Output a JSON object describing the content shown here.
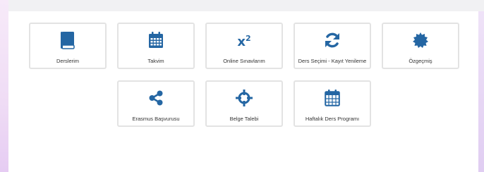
{
  "colors": {
    "icon": "#2466a3",
    "tile_border": "#e3e3e3",
    "label": "#333333"
  },
  "tiles": [
    {
      "label": "Derslerim",
      "icon": "book-icon"
    },
    {
      "label": "Takvim",
      "icon": "calendar-icon"
    },
    {
      "label": "Online Sınavlarım",
      "icon": "superscript-icon",
      "icon_text": "x",
      "icon_sup": "2"
    },
    {
      "label": "Ders Seçimi - Kayıt Yenileme",
      "icon": "refresh-icon"
    },
    {
      "label": "Özgeçmiş",
      "icon": "certificate-icon"
    },
    {
      "label": "Erasmus Başvurusu",
      "icon": "share-icon"
    },
    {
      "label": "Belge Talebi",
      "icon": "crosshairs-icon"
    },
    {
      "label": "Haftalık Ders Programı",
      "icon": "calendar-grid-icon"
    }
  ]
}
